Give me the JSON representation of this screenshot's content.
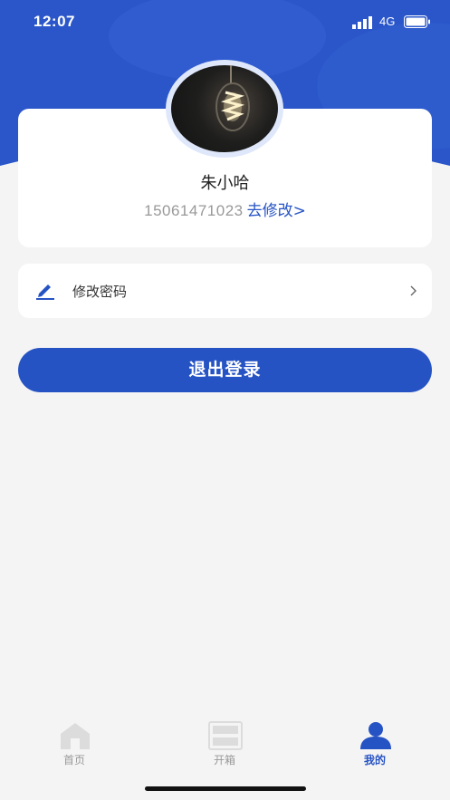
{
  "status_bar": {
    "time": "12:07",
    "network": "4G"
  },
  "profile": {
    "name": "朱小哈",
    "phone": "15061471023",
    "edit_link": "去修改>"
  },
  "menu": {
    "change_password": "修改密码"
  },
  "logout_label": "退出登录",
  "tabs": [
    {
      "label": "首页",
      "icon": "home-icon",
      "active": false
    },
    {
      "label": "开箱",
      "icon": "box-icon",
      "active": false
    },
    {
      "label": "我的",
      "icon": "user-icon",
      "active": true
    }
  ],
  "colors": {
    "accent": "#2653c4",
    "header": "#2a56c9",
    "background": "#f4f4f4"
  }
}
